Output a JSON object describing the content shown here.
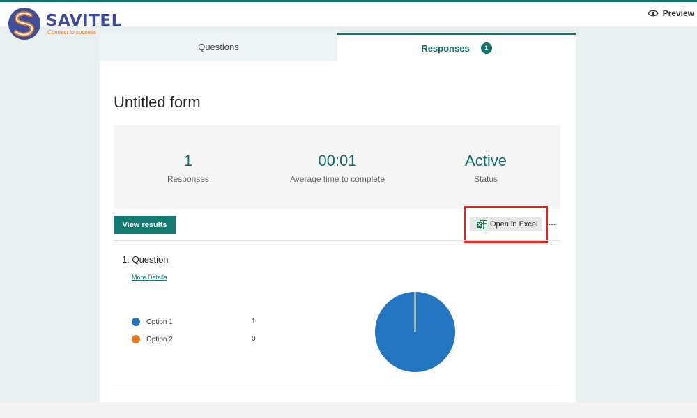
{
  "brand": {
    "name": "SAVITEL",
    "tagline": "Connect to success"
  },
  "header": {
    "preview_label": "Preview"
  },
  "tabs": [
    {
      "label": "Questions",
      "active": false
    },
    {
      "label": "Responses",
      "active": true,
      "badge": "1"
    }
  ],
  "form": {
    "title": "Untitled form"
  },
  "stats": [
    {
      "value": "1",
      "label": "Responses"
    },
    {
      "value": "00:01",
      "label": "Average time to complete"
    },
    {
      "value": "Active",
      "label": "Status"
    }
  ],
  "toolbar": {
    "view_results_label": "View results",
    "open_excel_label": "Open in Excel",
    "more_label": "···"
  },
  "question": {
    "title": "1.  Question",
    "more_details_label": "More Details",
    "options": [
      {
        "label": "Option 1",
        "count": "1",
        "color": "#2475c0"
      },
      {
        "label": "Option 2",
        "count": "0",
        "color": "#e87722"
      }
    ]
  },
  "colors": {
    "accent": "#13706b",
    "highlight_frame": "#e2231a"
  }
}
